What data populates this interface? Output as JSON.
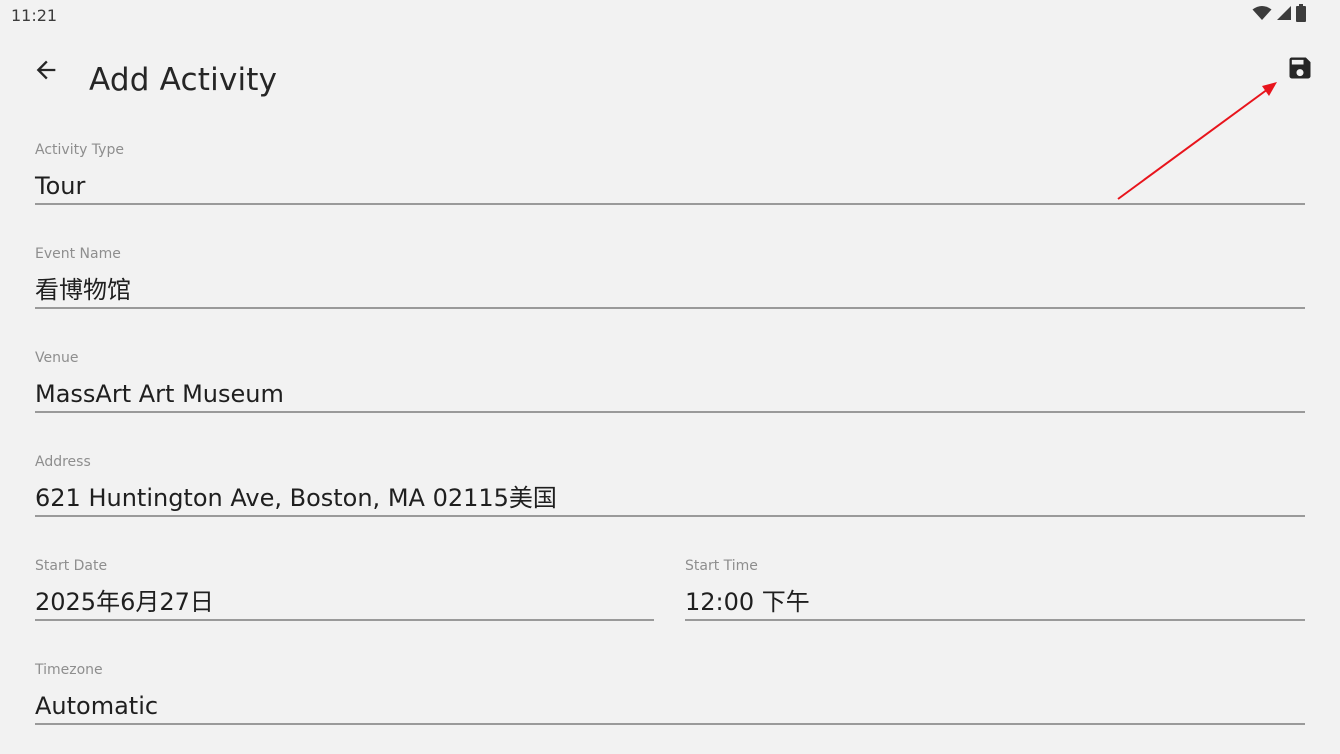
{
  "status_bar": {
    "time": "11:21",
    "icons": [
      "wifi-icon",
      "signal-icon",
      "battery-icon"
    ]
  },
  "app_bar": {
    "title": "Add Activity",
    "back_icon": "arrow-back-icon",
    "save_icon": "save-icon"
  },
  "form": {
    "activity_type": {
      "label": "Activity Type",
      "value": "Tour"
    },
    "event_name": {
      "label": "Event Name",
      "value": "看博物馆"
    },
    "venue": {
      "label": "Venue",
      "value": "MassArt Art Museum"
    },
    "address": {
      "label": "Address",
      "value": "621 Huntington Ave, Boston, MA 02115美国"
    },
    "start_date": {
      "label": "Start Date",
      "value": "2025年6月27日"
    },
    "start_time": {
      "label": "Start Time",
      "value": "12:00 下午"
    },
    "timezone": {
      "label": "Timezone",
      "value": "Automatic"
    }
  },
  "colors": {
    "background": "#f2f2f2",
    "text_primary": "#1f1f1f",
    "label": "#8e8e8e",
    "underline": "#9a9a9a",
    "annotation": "#e8141c"
  }
}
